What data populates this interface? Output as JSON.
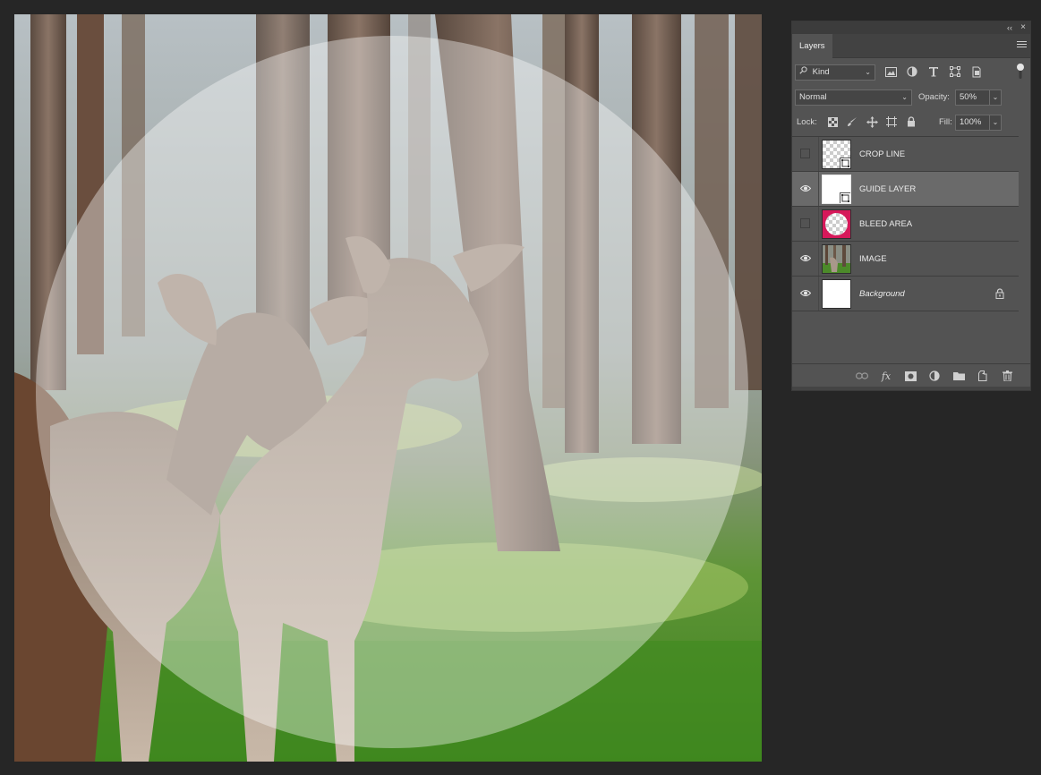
{
  "panel": {
    "collapse_glyph": "‹‹",
    "close_glyph": "×",
    "tab_label": "Layers",
    "menu_icon": "panel-menu-icon"
  },
  "filter": {
    "kind_label": "Kind",
    "icons": [
      "image-filter-icon",
      "adjustment-filter-icon",
      "type-filter-icon",
      "shape-filter-icon",
      "smart-object-filter-icon",
      "filter-toggle-icon"
    ]
  },
  "blend": {
    "mode": "Normal",
    "opacity_label": "Opacity:",
    "opacity_value": "50%"
  },
  "lock": {
    "label": "Lock:",
    "icons": [
      "lock-transparent-icon",
      "lock-paint-icon",
      "lock-position-icon",
      "lock-artboard-icon",
      "lock-all-icon"
    ],
    "fill_label": "Fill:",
    "fill_value": "100%"
  },
  "layers": [
    {
      "name": "CROP LINE",
      "visible": false,
      "selected": false,
      "italic": false,
      "thumb": "checker-smart"
    },
    {
      "name": "GUIDE LAYER",
      "visible": true,
      "selected": true,
      "italic": false,
      "thumb": "white-smart"
    },
    {
      "name": "BLEED AREA",
      "visible": false,
      "selected": false,
      "italic": false,
      "thumb": "magenta-circle"
    },
    {
      "name": "IMAGE",
      "visible": true,
      "selected": false,
      "italic": false,
      "thumb": "photo"
    },
    {
      "name": "Background",
      "visible": true,
      "selected": false,
      "italic": true,
      "thumb": "white",
      "locked": true
    }
  ],
  "bottom_icons": [
    "link-layers-icon",
    "fx-icon",
    "layer-mask-icon",
    "adjustment-layer-icon",
    "new-group-icon",
    "new-layer-icon",
    "trash-icon"
  ],
  "fx_label": "fx",
  "colors": {
    "app_bg": "#262626",
    "panel_bg": "#535353",
    "selected_row": "#6a6a6a",
    "bleed_magenta": "#d6195a"
  }
}
